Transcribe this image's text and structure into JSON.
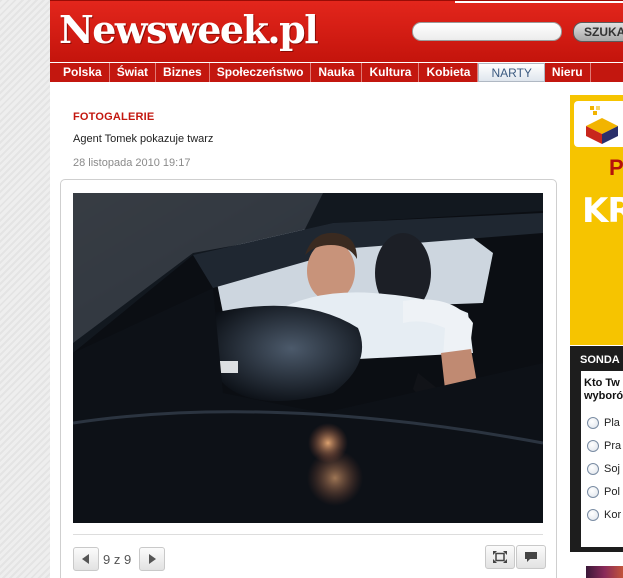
{
  "header": {
    "logo": "Newsweek.pl",
    "search_placeholder": "",
    "search_button": "SZUKA"
  },
  "nav": {
    "items": [
      {
        "label": "Polska",
        "active": false
      },
      {
        "label": "Świat",
        "active": false
      },
      {
        "label": "Biznes",
        "active": false
      },
      {
        "label": "Społeczeństwo",
        "active": false
      },
      {
        "label": "Nauka",
        "active": false
      },
      {
        "label": "Kultura",
        "active": false
      },
      {
        "label": "Kobieta",
        "active": false
      },
      {
        "label": "NARTY",
        "active": true
      },
      {
        "label": "Nieru",
        "active": false
      }
    ]
  },
  "article": {
    "category": "FOTOGALERIE",
    "title": "Agent Tomek pokazuje twarz",
    "date": "28 listopada 2010 19:17"
  },
  "gallery": {
    "counter": "9 z 9",
    "current": 9,
    "total": 9
  },
  "sidebar": {
    "ad": {
      "line1": "P",
      "line2": "KR"
    },
    "poll": {
      "header": "SONDA",
      "question_line1": "Kto Tw",
      "question_line2": "wyboró",
      "options": [
        "Pla",
        "Pra",
        "Soj",
        "Pol",
        "Kor"
      ]
    }
  },
  "colors": {
    "brand_red": "#c3170f",
    "nav_active_text": "#3b5a80",
    "ad_yellow": "#f6c400",
    "poll_dark": "#1d1d1d"
  }
}
